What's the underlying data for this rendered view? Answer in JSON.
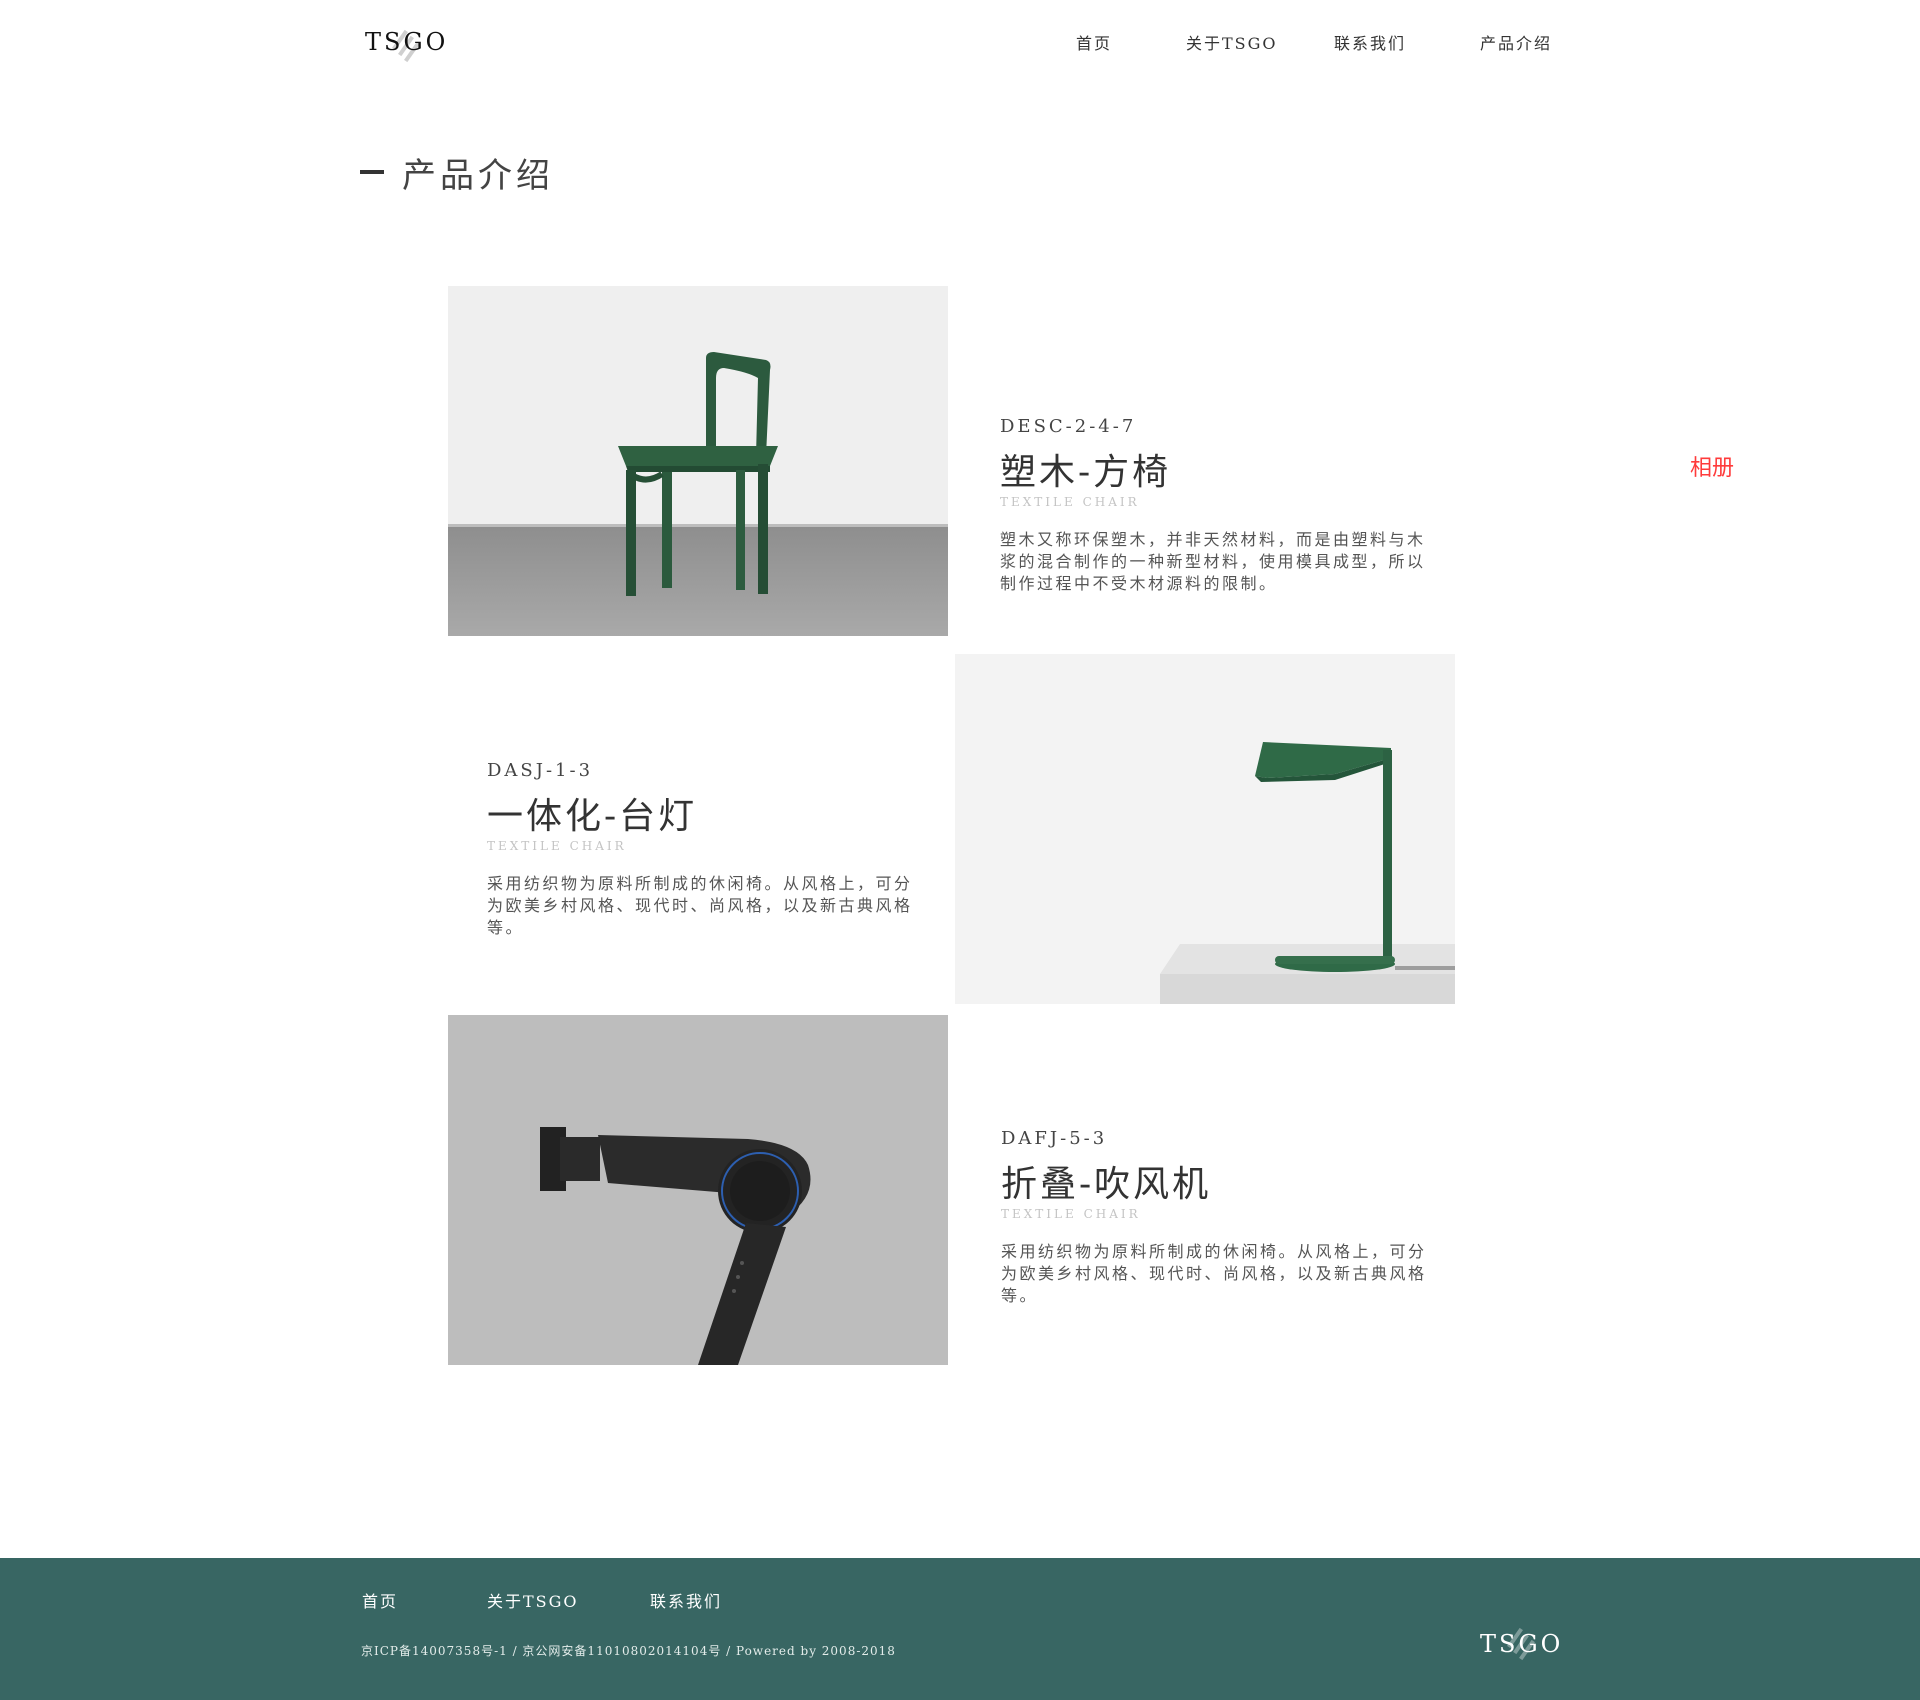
{
  "header": {
    "logo": "TSGO",
    "nav": [
      "首页",
      "关于TSGO",
      "联系我们",
      "产品介绍"
    ]
  },
  "section": {
    "title": "产品介绍"
  },
  "products": [
    {
      "code": "DESC-2-4-7",
      "name": "塑木-方椅",
      "subtitle": "TEXTILE CHAIR",
      "description": "塑木又称环保塑木，并非天然材料，而是由塑料与木浆的混合制作的一种新型材料，使用模具成型，所以制作过程中不受木材源料的限制。",
      "image_icon": "green-chair-image"
    },
    {
      "code": "DASJ-1-3",
      "name": "一体化-台灯",
      "subtitle": "TEXTILE CHAIR",
      "description": "采用纺织物为原料所制成的休闲椅。从风格上，可分为欧美乡村风格、现代时、尚风格，以及新古典风格等。",
      "image_icon": "green-lamp-image"
    },
    {
      "code": "DAFJ-5-3",
      "name": "折叠-吹风机",
      "subtitle": "TEXTILE CHAIR",
      "description": "采用纺织物为原料所制成的休闲椅。从风格上，可分为欧美乡村风格、现代时、尚风格，以及新古典风格等。",
      "image_icon": "black-hairdryer-image"
    }
  ],
  "album_link": "相册",
  "footer": {
    "nav": [
      "首页",
      "关于TSGO",
      "联系我们"
    ],
    "copyright": "京ICP备14007358号-1 / 京公网安备11010802014104号 / Powered by 2008-2018",
    "logo": "TSGO"
  },
  "colors": {
    "footer_bg": "#386663",
    "product_green": "#2c5a3e",
    "album_link": "#ff3b3b"
  }
}
